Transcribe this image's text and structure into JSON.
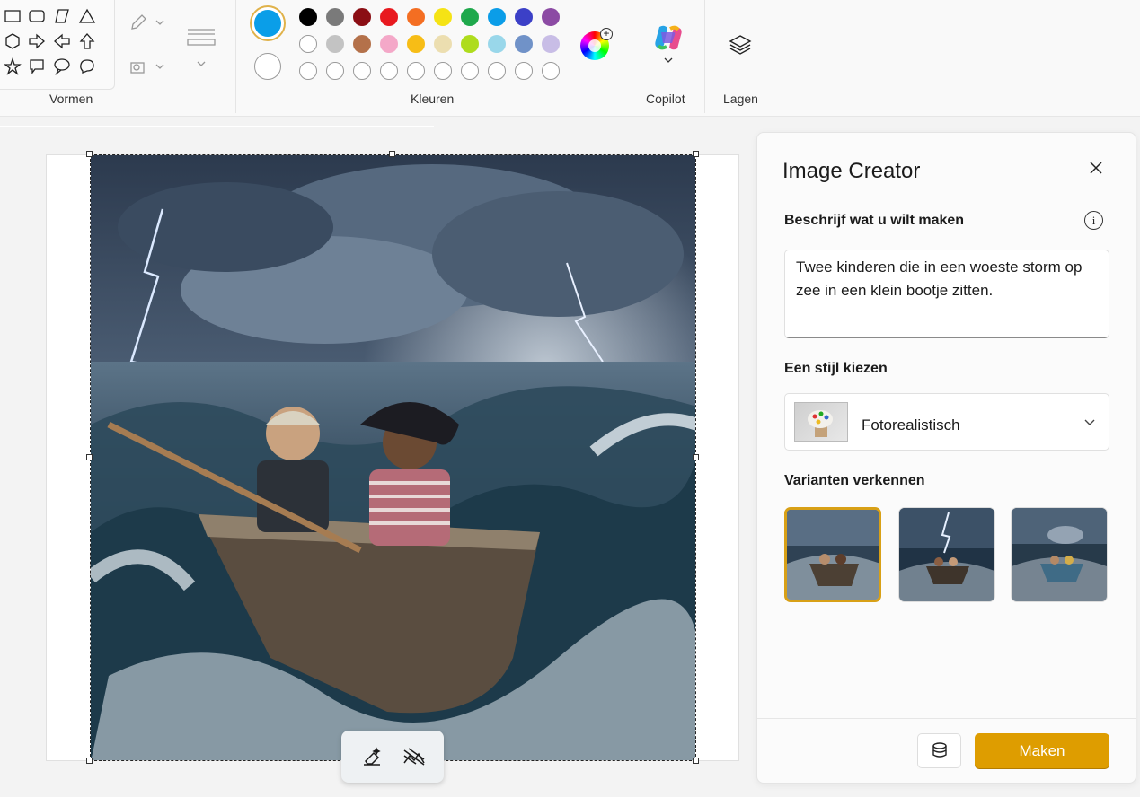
{
  "ribbon": {
    "shapes_label": "Vormen",
    "colors_label": "Kleuren",
    "copilot_label": "Copilot",
    "layers_label": "Lagen",
    "shapes": [
      "rectangle-icon",
      "rounded-rectangle-icon",
      "parallelogram-icon",
      "triangle-icon",
      "hexagon-icon",
      "arrow-right-icon",
      "arrow-left-icon",
      "arrow-up-icon",
      "star-icon",
      "speech-bubble-rect-icon",
      "speech-bubble-oval-icon",
      "thought-bubble-icon"
    ],
    "primary_color": "#0a9ee8",
    "secondary_color": "#ffffff",
    "palette_row1": [
      "#000000",
      "#7a7a7a",
      "#8b0e14",
      "#e8191f",
      "#f46e22",
      "#f5e315",
      "#1ea84b",
      "#0b9de8",
      "#3c40c7",
      "#8c4ba4"
    ],
    "palette_row2": [
      "#ffffff",
      "#c3c3c3",
      "#b4714a",
      "#f4a8c8",
      "#f7bd16",
      "#ecdeb0",
      "#aedc1d",
      "#99d7ea",
      "#7092c8",
      "#c8bde6"
    ]
  },
  "canvas": {
    "toolbar": [
      "erase-background-icon",
      "remove-background-icon"
    ]
  },
  "panel": {
    "title": "Image Creator",
    "describe_label": "Beschrijf wat u wilt maken",
    "info_glyph": "i",
    "prompt_value": "Twee kinderen die in een woeste storm op zee in een klein bootje zitten.",
    "style_label": "Een stijl kiezen",
    "style_value": "Fotorealistisch",
    "variants_label": "Varianten verkennen",
    "selected_variant": 1,
    "make_label": "Maken"
  }
}
